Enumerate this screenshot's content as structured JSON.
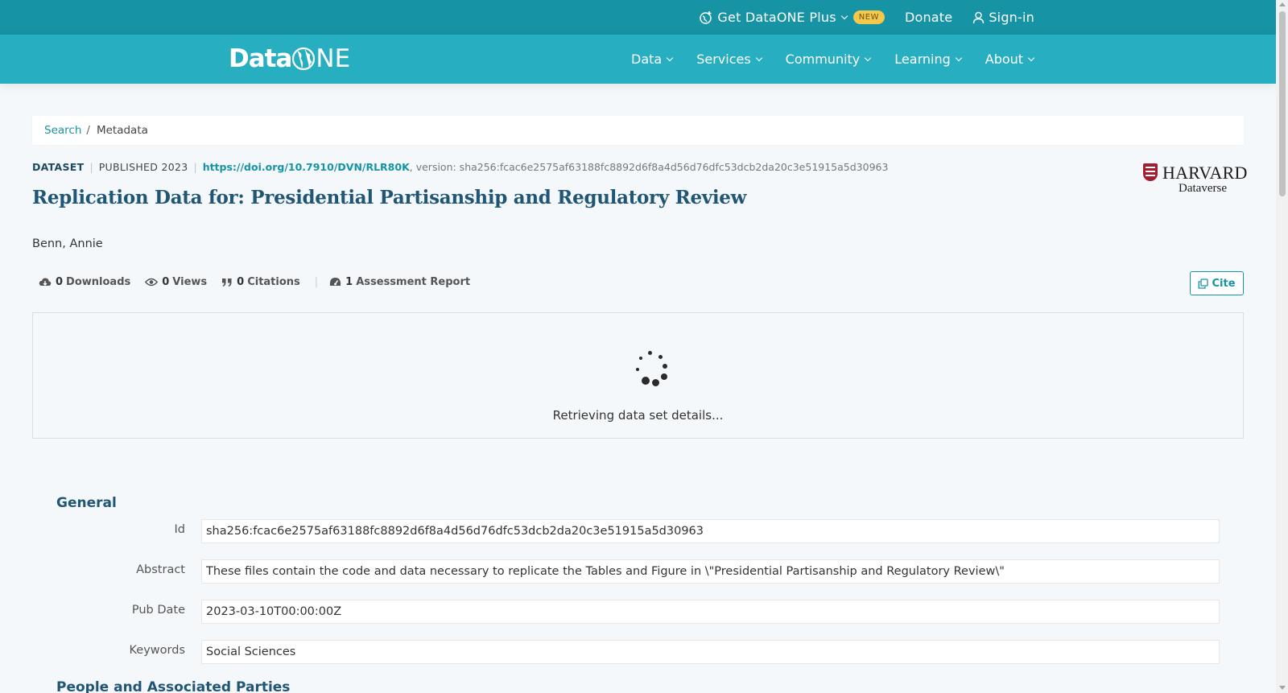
{
  "topbar": {
    "plus_label": "Get DataONE Plus",
    "plus_badge": "NEW",
    "donate_label": "Donate",
    "signin_label": "Sign-in"
  },
  "logo": {
    "data": "Data",
    "one": "NE"
  },
  "nav": {
    "items": [
      {
        "label": "Data"
      },
      {
        "label": "Services"
      },
      {
        "label": "Community"
      },
      {
        "label": "Learning"
      },
      {
        "label": "About"
      }
    ]
  },
  "breadcrumb": {
    "search": "Search",
    "separator": "/",
    "current": "Metadata"
  },
  "dataset": {
    "type": "DATASET",
    "published": "PUBLISHED 2023",
    "doi": "https://doi.org/10.7910/DVN/RLR80K",
    "version": ", version: sha256:fcac6e2575af63188fc8892d6f8a4d56d76dfc53dcb2da20c3e51915a5d30963",
    "title": "Replication Data for: Presidential Partisanship and Regulatory Review",
    "author": "Benn, Annie"
  },
  "repository_logo": {
    "name": "HARVARD",
    "sub": "Dataverse"
  },
  "stats": {
    "downloads_count": "0",
    "downloads_label": "Downloads",
    "views_count": "0",
    "views_label": "Views",
    "citations_count": "0",
    "citations_label": "Citations",
    "assessment_count": "1",
    "assessment_label": "Assessment Report"
  },
  "cite_label": "Cite",
  "loading_text": "Retrieving data set details...",
  "general": {
    "title": "General",
    "rows": [
      {
        "label": "Id",
        "value": "sha256:fcac6e2575af63188fc8892d6f8a4d56d76dfc53dcb2da20c3e51915a5d30963"
      },
      {
        "label": "Abstract",
        "value": "These files contain the code and data necessary to replicate the Tables and Figure in \\\"Presidential Partisanship and Regulatory Review\\\""
      },
      {
        "label": "Pub Date",
        "value": "2023-03-10T00:00:00Z"
      },
      {
        "label": "Keywords",
        "value": "Social Sciences"
      }
    ]
  },
  "people_section_title": "People and Associated Parties",
  "colors": {
    "topbar": "#1693a5",
    "nav": "#27aec0",
    "title": "#1f5675",
    "accent": "#1693a5",
    "badge": "#f5c84c"
  }
}
